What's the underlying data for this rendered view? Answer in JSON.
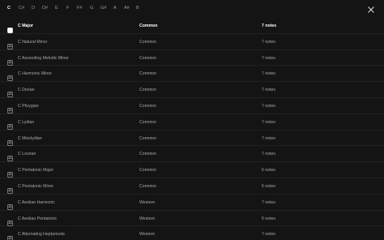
{
  "keys": [
    "C",
    "C#",
    "D",
    "D#",
    "E",
    "F",
    "F#",
    "G",
    "G#",
    "A",
    "A#",
    "B"
  ],
  "active_key": "C",
  "icons": {
    "scale": "piano-keys-icon",
    "close": "close-icon"
  },
  "colors": {
    "background": "#141414",
    "text_active": "#ffffff",
    "text_muted": "#a8a8a8"
  },
  "scales": [
    {
      "name": "C Major",
      "category": "Common",
      "notes": "7 notes"
    },
    {
      "name": "C Natural Minor",
      "category": "Common",
      "notes": "7 notes"
    },
    {
      "name": "C Ascending Melodic Minor",
      "category": "Common",
      "notes": "7 notes"
    },
    {
      "name": "C Harmonic Minor",
      "category": "Common",
      "notes": "7 notes"
    },
    {
      "name": "C Dorian",
      "category": "Common",
      "notes": "7 notes"
    },
    {
      "name": "C Phrygian",
      "category": "Common",
      "notes": "7 notes"
    },
    {
      "name": "C Lydian",
      "category": "Common",
      "notes": "7 notes"
    },
    {
      "name": "C Mixolydian",
      "category": "Common",
      "notes": "7 notes"
    },
    {
      "name": "C Locrian",
      "category": "Common",
      "notes": "7 notes"
    },
    {
      "name": "C Pentatonic Major",
      "category": "Common",
      "notes": "5 notes"
    },
    {
      "name": "C Pentatonic Minor",
      "category": "Common",
      "notes": "5 notes"
    },
    {
      "name": "C Aeolian Harmonic",
      "category": "Western",
      "notes": "7 notes"
    },
    {
      "name": "C Aeolian Pentatonic",
      "category": "Western",
      "notes": "5 notes"
    },
    {
      "name": "C Alternating Heptamode",
      "category": "Western",
      "notes": "7 notes"
    }
  ]
}
